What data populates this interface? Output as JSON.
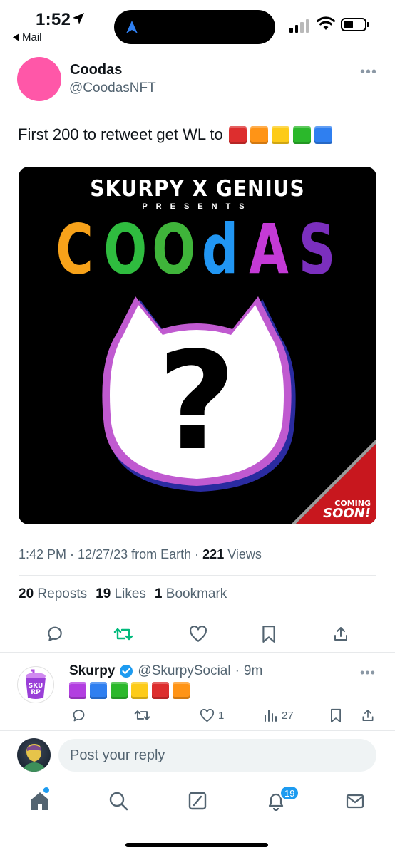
{
  "status_bar": {
    "time": "1:52",
    "back_label": "Mail"
  },
  "tweet": {
    "author_name": "Coodas",
    "author_handle": "@CoodasNFT",
    "avatar_color": "#ff57a8",
    "text": "First 200 to retweet get WL to",
    "emoji_squares": [
      "#dd2e2e",
      "#ff9416",
      "#fdcb18",
      "#2bb82b",
      "#2f7ff0"
    ],
    "media": {
      "top_line": "SKURPY X GENIUS",
      "presents": "PRESENTS",
      "logo_letters": [
        "C",
        "O",
        "O",
        "d",
        "A",
        "S"
      ],
      "logo_colors": [
        "#f7a21a",
        "#2fbc3f",
        "#3fb43a",
        "#2196f3",
        "#c43ad6",
        "#7b2fbe"
      ],
      "question_mark": "?",
      "badge_line1": "COMING",
      "badge_line2": "SOON!"
    },
    "meta": {
      "time": "1:42 PM",
      "date": "12/27/23",
      "source": "from Earth",
      "views_count": "221",
      "views_label": "Views"
    },
    "stats": {
      "reposts_count": "20",
      "reposts_label": "Reposts",
      "likes_count": "19",
      "likes_label": "Likes",
      "bookmarks_count": "1",
      "bookmarks_label": "Bookmark"
    }
  },
  "reply": {
    "name": "Skurpy",
    "handle": "@SkurpySocial",
    "time": "9m",
    "emoji_squares": [
      "#b23ee0",
      "#2f7ff0",
      "#2bb82b",
      "#fdcb18",
      "#dd2e2e",
      "#ff9416"
    ],
    "like_count": "1",
    "views_count": "27"
  },
  "composer": {
    "placeholder": "Post your reply"
  },
  "tab_bar": {
    "notifications_badge": "19"
  },
  "colors": {
    "accent": "#1d9bf0",
    "retweet_green": "#00ba7c",
    "secondary_text": "#536471"
  }
}
